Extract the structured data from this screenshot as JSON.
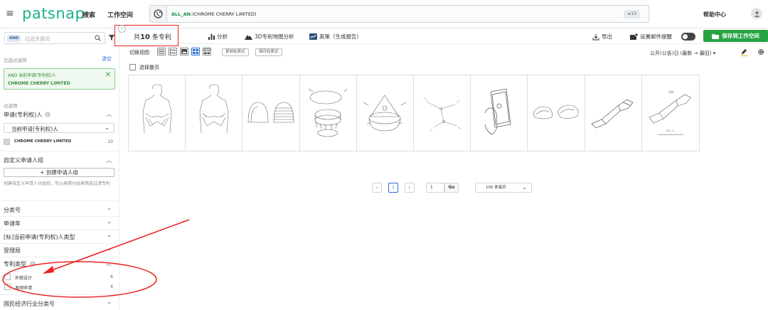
{
  "header": {
    "logo": "patsnap",
    "nav": [
      "搜索",
      "工作空间"
    ],
    "search_query_prefix": "ALL_AN",
    "search_query_rest": ":(CHROME CHERRY LIMITED)",
    "search_count": "≡13",
    "help": "帮助中心"
  },
  "sidebar": {
    "and_tag": "AND",
    "filter_placeholder": "过滤关键词",
    "selected_label": "已选过滤项",
    "clear": "清空",
    "applied_line1": "AND 当前申请(专利权)人",
    "applied_line2": "CHROME CHERRY LIMITED",
    "filters_label": "过滤项",
    "applicant_title": "申请(专利权)人",
    "applicant_select": "当前申请(专利权)人",
    "applicant_option": "CHROME CHERRY LIMITED",
    "applicant_count": "10",
    "custom_group_title": "自定义申请人组",
    "create_group": "+ 创建申请人组",
    "create_hint": "创建自定义申请人分组后，可以按照分组来筛选过滤专利",
    "sections": [
      "分类号",
      "申请年",
      "[标]当前申请(专利权)人类型",
      "受理局"
    ],
    "patent_type_title": "专利类型",
    "patent_types": [
      {
        "label": "外观设计",
        "count": "6"
      },
      {
        "label": "发明申请",
        "count": "4"
      }
    ],
    "last_section": "国民经济行业分类号"
  },
  "toolbar": {
    "total_prefix": "共",
    "total_num": "10",
    "total_suffix": "条专利",
    "analysis": "分析",
    "map3d": "3D专利地图分析",
    "insight": "英策（生成报告）",
    "export": "导出",
    "email_alert": "设置邮件提醒",
    "save_workspace": "保存到工作空间"
  },
  "subtoolbar": {
    "switch_view": "切换视图",
    "copy_query": "复制检索式",
    "save_query": "保存检索式",
    "sort": "公开(公告)日 (最新 → 最旧)",
    "select_page": "选择整页"
  },
  "pagination": {
    "current": "1",
    "jump_value": "1",
    "go": "Go",
    "per_page": "100 条每页"
  },
  "colors": {
    "brand": "#1bb18c",
    "save_button": "#25a342",
    "annotation": "#e22222",
    "link": "#2d6ccf"
  }
}
